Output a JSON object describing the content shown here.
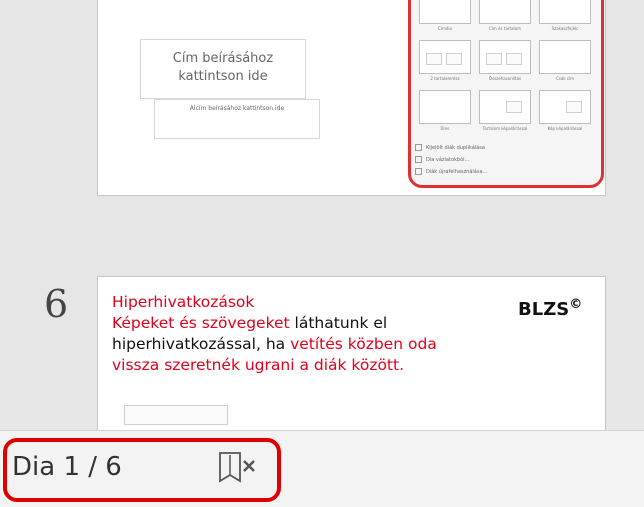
{
  "slide5": {
    "title_placeholder": "Cím beírásához kattintson ide",
    "subtitle_placeholder": "Alcím beírásához kattintson ide",
    "layout_labels": [
      "Címdia",
      "Cím és tartalom",
      "Szakaszfejléc",
      "2 tartalomrész",
      "Összehasonlítás",
      "Csak cím",
      "Üres",
      "Tartalom képaláírással",
      "Kép képaláírással"
    ],
    "layout_menu": [
      "Kijelölt diák duplikálása",
      "Dia vázlatokból...",
      "Diák újrafelhasználása..."
    ]
  },
  "slide6": {
    "number": "6",
    "heading": "Hiperhivatkozások",
    "line1_red": "Képeket és szövegeket",
    "line1_black": " láthatunk el",
    "line2_black": "hiperhivatkozással, ha ",
    "line2_red": "vetítés közben oda",
    "line3_red": "vissza szeretnék ugrani a diák között.",
    "logo": "BLZS",
    "logo_sup": "©"
  },
  "statusbar": {
    "slide_count": "Dia 1 / 6",
    "notes_icon": "notes-icon"
  },
  "colors": {
    "highlight": "#e00000",
    "text_red": "#e2001a",
    "background": "#e6e6e6"
  }
}
